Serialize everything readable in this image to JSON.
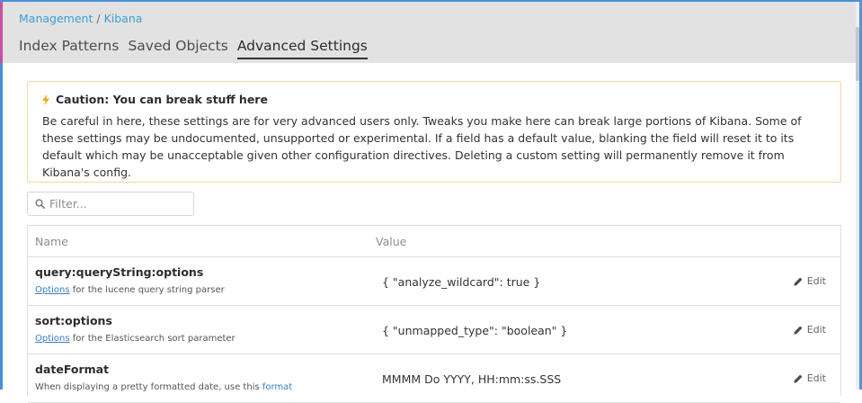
{
  "breadcrumbs": {
    "management": "Management",
    "separator": "/",
    "kibana": "Kibana"
  },
  "tabs": [
    {
      "label": "Index Patterns",
      "active": false
    },
    {
      "label": "Saved Objects",
      "active": false
    },
    {
      "label": "Advanced Settings",
      "active": true
    }
  ],
  "caution": {
    "icon": "bolt-icon",
    "title": "Caution: You can break stuff here",
    "body": "Be careful in here, these settings are for very advanced users only. Tweaks you make here can break large portions of Kibana. Some of these settings may be undocumented, unsupported or experimental. If a field has a default value, blanking the field will reset it to its default which may be unacceptable given other configuration directives. Deleting a custom setting will permanently remove it from Kibana's config."
  },
  "filter": {
    "placeholder": "Filter...",
    "value": ""
  },
  "table": {
    "columns": {
      "name": "Name",
      "value": "Value"
    },
    "rows": [
      {
        "name": "query:queryString:options",
        "desc_link": "Options",
        "desc_text": " for the lucene query string parser",
        "value": "{ \"analyze_wildcard\": true }",
        "edit_label": "Edit"
      },
      {
        "name": "sort:options",
        "desc_link": "Options",
        "desc_text": " for the Elasticsearch sort parameter",
        "value": "{ \"unmapped_type\": \"boolean\" }",
        "edit_label": "Edit"
      },
      {
        "name": "dateFormat",
        "desc_text": "When displaying a pretty formatted date, use this ",
        "desc_link": "format",
        "value": "MMMM Do YYYY, HH:mm:ss.SSS",
        "edit_label": "Edit"
      }
    ]
  },
  "colors": {
    "accent": "#3b9fd3",
    "warning": "#f5a623",
    "header_bg": "#e2e2e2"
  }
}
